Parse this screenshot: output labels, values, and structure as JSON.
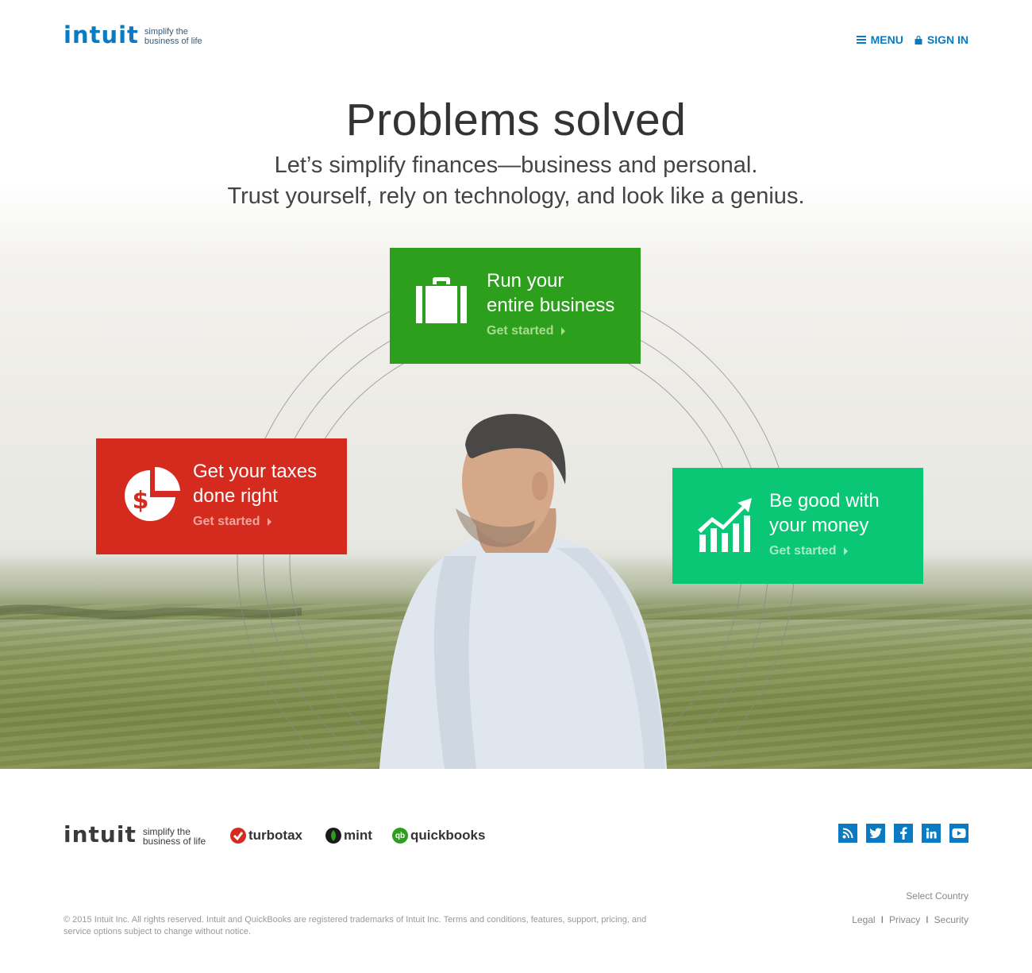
{
  "header": {
    "logo_word": "intuit",
    "logo_tagline_line1": "simplify the",
    "logo_tagline_line2": "business of life",
    "menu_label": "MENU",
    "signin_label": "SIGN IN"
  },
  "hero": {
    "headline": "Problems solved",
    "subline1": "Let’s simplify finances—business and personal.",
    "subline2": "Trust yourself, rely on technology, and look like a genius."
  },
  "cards": {
    "business": {
      "line1": "Run your",
      "line2": "entire business",
      "cta": "Get started",
      "icon": "briefcase-icon",
      "color": "#2ca01c"
    },
    "taxes": {
      "line1": "Get your taxes",
      "line2": "done right",
      "cta": "Get started",
      "icon": "dollar-pie-chart-icon",
      "color": "#d52b1e"
    },
    "money": {
      "line1": "Be good with",
      "line2": "your money",
      "cta": "Get started",
      "icon": "growth-chart-icon",
      "color": "#0ac775"
    }
  },
  "footer": {
    "logo_word": "intuit",
    "logo_tagline_line1": "simplify the",
    "logo_tagline_line2": "business of life",
    "brands": [
      {
        "name": "turbotax",
        "icon": "turbotax-check-icon",
        "color": "#d52b1e"
      },
      {
        "name": "mint",
        "icon": "mint-leaf-icon",
        "color": "#1a1a1a"
      },
      {
        "name": "quickbooks",
        "icon": "quickbooks-qb-icon",
        "color": "#2ca01c",
        "badge_text": "qb"
      }
    ],
    "social": [
      "rss-icon",
      "twitter-icon",
      "facebook-icon",
      "linkedin-icon",
      "youtube-icon"
    ],
    "select_country": "Select Country",
    "legal": "Legal",
    "privacy": "Privacy",
    "security": "Security",
    "separator": "I",
    "copyright": "© 2015 Intuit Inc. All rights reserved. Intuit and QuickBooks are registered trademarks of Intuit Inc. Terms and conditions, features, support, pricing, and service options subject to change without notice."
  },
  "colors": {
    "brand_blue": "#0a7bc2",
    "business_green": "#2ca01c",
    "taxes_red": "#d52b1e",
    "money_green": "#0ac775"
  }
}
